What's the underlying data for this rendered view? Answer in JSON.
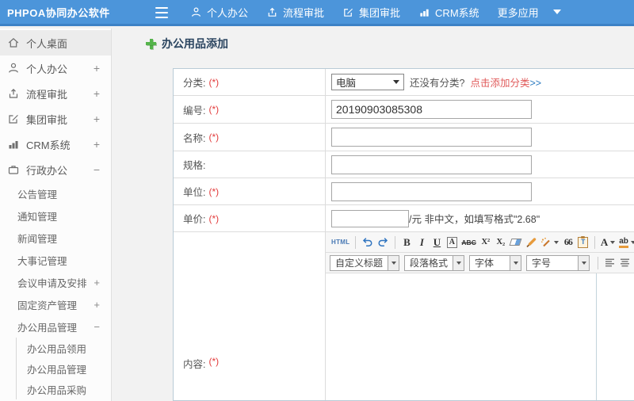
{
  "topbar": {
    "logo": "PHPOA协同办公软件",
    "nav": [
      {
        "label": "个人办公"
      },
      {
        "label": "流程审批"
      },
      {
        "label": "集团审批"
      },
      {
        "label": "CRM系统"
      },
      {
        "label": "更多应用"
      }
    ]
  },
  "sidebar": {
    "items": [
      {
        "label": "个人桌面",
        "expander": ""
      },
      {
        "label": "个人办公",
        "expander": "+"
      },
      {
        "label": "流程审批",
        "expander": "+"
      },
      {
        "label": "集团审批",
        "expander": "+"
      },
      {
        "label": "CRM系统",
        "expander": "+"
      },
      {
        "label": "行政办公",
        "expander": "−"
      }
    ],
    "admin_children": [
      {
        "label": "公告管理",
        "expander": ""
      },
      {
        "label": "通知管理",
        "expander": ""
      },
      {
        "label": "新闻管理",
        "expander": ""
      },
      {
        "label": "大事记管理",
        "expander": ""
      },
      {
        "label": "会议申请及安排",
        "expander": "+"
      },
      {
        "label": "固定资产管理",
        "expander": "+"
      },
      {
        "label": "办公用品管理",
        "expander": "−"
      }
    ],
    "supplies_children": [
      {
        "label": "办公用品领用"
      },
      {
        "label": "办公用品管理"
      },
      {
        "label": "办公用品采购"
      }
    ]
  },
  "main": {
    "title": "办公用品添加",
    "form": {
      "category": {
        "label": "分类:",
        "required": "(*)",
        "value": "电脑",
        "hint": "还没有分类?",
        "link": "点击添加分类",
        "arrows": ">>"
      },
      "code": {
        "label": "编号:",
        "required": "(*)",
        "value": "20190903085308"
      },
      "name": {
        "label": "名称:",
        "required": "(*)"
      },
      "spec": {
        "label": "规格:",
        "required": ""
      },
      "unit": {
        "label": "单位:",
        "required": "(*)"
      },
      "price": {
        "label": "单价:",
        "required": "(*)",
        "suffix": "/元 非中文，如填写格式\"2.68\""
      },
      "content": {
        "label": "内容:",
        "required": "(*)"
      }
    },
    "editor": {
      "buttons": {
        "html": "HTML",
        "bold": "B",
        "italic": "I",
        "underline": "U",
        "box_a": "A",
        "strike": "ABC",
        "sup": "X²",
        "sub": "X₂",
        "quote": "66",
        "paste_glyph": "T",
        "font_color": "A",
        "bg_color": "ab"
      },
      "selects": [
        {
          "label": "自定义标题"
        },
        {
          "label": "段落格式"
        },
        {
          "label": "字体"
        },
        {
          "label": "字号"
        }
      ]
    }
  }
}
